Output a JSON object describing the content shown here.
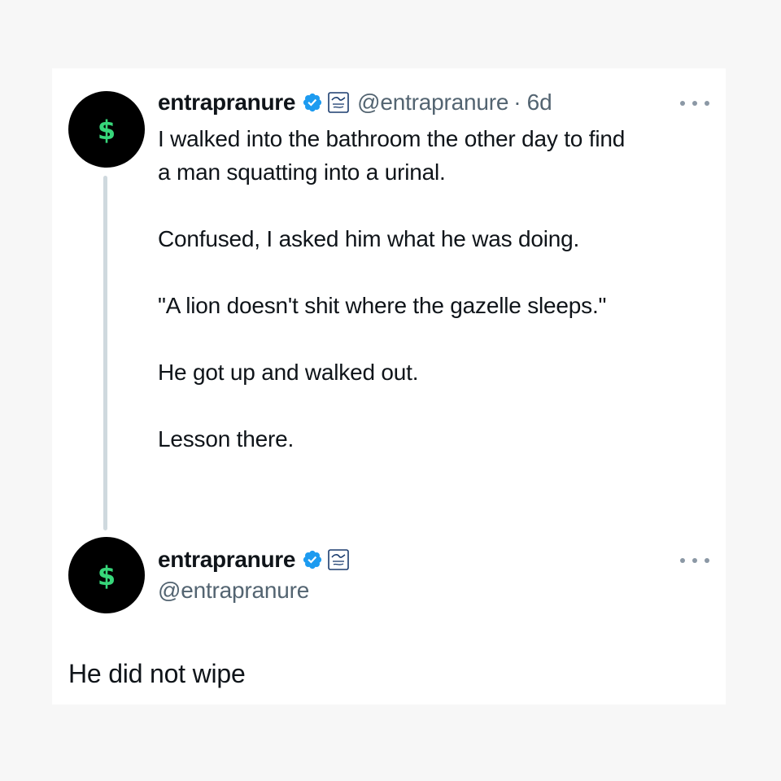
{
  "thread": [
    {
      "avatar_symbol": "$",
      "display_name": "entrapranure",
      "handle": "@entrapranure",
      "separator": "·",
      "time": "6d",
      "verified_badge_icon": "verified-badge-icon",
      "affiliate_badge_icon": "friday-beers-badge-icon",
      "more_icon": "more-options-icon",
      "paragraphs": [
        "I walked into the bathroom the other day to find",
        "a man squatting into a urinal.",
        "Confused, I asked him what he was doing.",
        "\"A lion doesn't shit where the gazelle sleeps.\"",
        "He got up and walked out.",
        "Lesson there."
      ]
    },
    {
      "avatar_symbol": "$",
      "display_name": "entrapranure",
      "handle": "@entrapranure",
      "verified_badge_icon": "verified-badge-icon",
      "affiliate_badge_icon": "friday-beers-badge-icon",
      "more_icon": "more-options-icon",
      "text": "He did not wipe"
    }
  ],
  "colors": {
    "page_background": "#f7f7f7",
    "card_background": "#ffffff",
    "text_primary": "#0f1419",
    "text_secondary": "#536471",
    "verified_blue": "#1d9bf0",
    "avatar_background": "#000000",
    "avatar_symbol": "#37d67a",
    "thread_line": "#cfd9de"
  }
}
